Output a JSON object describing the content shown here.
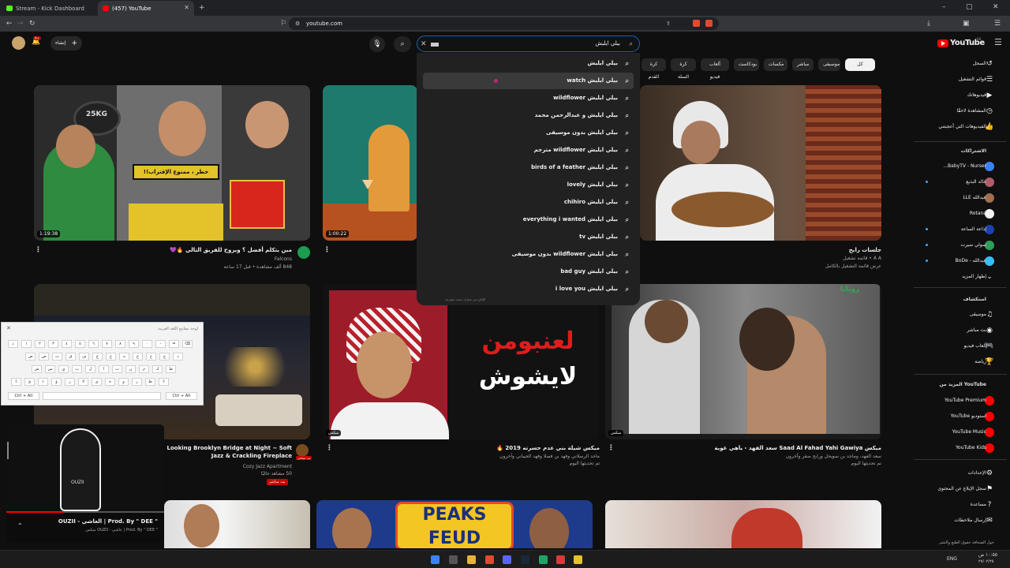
{
  "browser": {
    "tabs": [
      {
        "label": "Stream - Kick Dashboard",
        "active": false
      },
      {
        "label": "(457) YouTube",
        "active": true
      }
    ],
    "url": "youtube.com"
  },
  "youtube": {
    "logo": "YouTube",
    "region": "SA",
    "search_value": "بيلي ايليش",
    "create_label": "إنشاء",
    "notif_count": "9+",
    "chips": [
      "كل المحتوى",
      "موسيقى",
      "مباشر",
      "مكسات",
      "بودكاست",
      "ألعاب فيديو",
      "كرة السلة",
      "كرة القدم"
    ],
    "suggestions": [
      "بيلي ايليش",
      "بيلي ايليش watch",
      "بيلي ايليش wildflower",
      "بيلي ايليش و عبدالرحمن محمد",
      "بيلي ايليش بدون موسيقى",
      "بيلي ايليش wildflower مترجم",
      "بيلي ايليش birds of a feather",
      "بيلي ايليش lovely",
      "بيلي ايليش chihiro",
      "بيلي ايليش everything i wanted",
      "بيلي ايليش tv",
      "بيلي ايليش wildflower بدون موسيقى",
      "بيلي ايليش bad guy",
      "بيلي ايليش i love you"
    ],
    "suggest_footer": "الإبلاغ عن عبارات بحث مقترحة",
    "videos": [
      {
        "title": "مين يتكلم أفضل ؟ ويروح للفريق التالي 🔥💜",
        "channel": "Falcons",
        "meta": "848 ألف مشاهدة • قبل 17 ساعة",
        "duration": "1:19:38"
      },
      {
        "title": "",
        "channel": "",
        "meta": "",
        "duration": "1:00:22"
      },
      {
        "title": "جلسات رابح",
        "channel": "A A • قائمة تشغيل",
        "meta": "عرض قائمة التشغيل بالكامل",
        "duration": ""
      },
      {
        "title": "Looking Brooklyn Bridge at Night ~ Soft Jazz & Crackling Fireplace",
        "channel": "Cozy Jazz Apartment",
        "meta": "50 مشاهد حاليًا",
        "live": "بث مباشر"
      },
      {
        "title": "ميكس شيلة بني عدم حسرته 2019 🔥",
        "channel": "ماجد الرسلاني وفهد بن فصلا وفهد الجيباني وآخرون",
        "meta": "تم تحديثها اليوم",
        "mix": "ميكس"
      },
      {
        "title": "ميكس Saad Al Fahad Yahi Gawiya سعد الفهد - ياهي غوية",
        "channel": "سعد الفهد، وماجد بن سويحل ورابح صقر وآخرون",
        "meta": "تم تحديثها اليوم",
        "mix": "ميكس"
      }
    ],
    "thumb_texts": {
      "peaks": "PEAKS",
      "feud": "FEUD",
      "warning": "خطر ، ممنوع الإقتراب!!",
      "laanbo": "لعنبومن",
      "layshwsh": "لايشوش",
      "rotana": "روتانا",
      "kg": "25KG"
    },
    "sidebar": {
      "main": [
        "السجل",
        "قوائم التشغيل",
        "فيديوهاتك",
        "المشاهدة لاحقًا",
        "الفيديوهات التي أعجبتني"
      ],
      "subs_head": "الاشتراكات",
      "subs": [
        "BabyTV - Nurser...",
        "خالد البذيع",
        "عبدالله LLE",
        "Rotana",
        "إذاعة الساعة",
        "سولي سيرت",
        "عبدالله - BoDe"
      ],
      "show_more": "إظهار المزيد",
      "explore_head": "استكشاف",
      "explore": [
        "موسيقى",
        "بث مباشر",
        "ألعاب فيديو",
        "رياضة"
      ],
      "more_head": "المزيد من YouTube",
      "more": [
        "YouTube Premium",
        "استوديو YouTube",
        "YouTube Music",
        "YouTube Kids"
      ],
      "settings": [
        "الإعدادات",
        "سجل الإبلاغ عن المحتوى",
        "مساعدة",
        "إرسال ملاحظات"
      ],
      "footer": "حول   الصحافة   حقوق الطبع والنشر"
    },
    "miniplayer": {
      "title": "\" Prod. By \" DEE | العاشي - OUZII",
      "sub": "\" Prod. By \" DEE | عاشي - OUZII ميكس",
      "ouzii": "OUZII"
    }
  },
  "keyboard": {
    "title": "لوحة مفاتيح اللغة العربية",
    "row1": [
      "ذ",
      "١",
      "٢",
      "٣",
      "٤",
      "٥",
      "٦",
      "٧",
      "٨",
      "٩",
      "٠",
      "-",
      "=",
      "⌫"
    ],
    "row2": [
      "ض",
      "ص",
      "ث",
      "ق",
      "ف",
      "غ",
      "ع",
      "ه",
      "خ",
      "ح",
      "ج",
      "د"
    ],
    "row3": [
      "ش",
      "س",
      "ي",
      "ب",
      "ل",
      "ا",
      "ت",
      "ن",
      "م",
      "ك",
      "ط"
    ],
    "row4": [
      "⇧",
      "ئ",
      "ء",
      "ؤ",
      "ر",
      "لا",
      "ى",
      "ة",
      "و",
      "ز",
      "ظ",
      "⇧"
    ],
    "ctrl_alt": "Ctrl + Alt"
  },
  "taskbar": {
    "lang": "ENG",
    "time": "١٠:٥٥ ص",
    "date": "٢٧/٠٢/٢٥"
  },
  "colors": {
    "bg": "#0f0f0f",
    "accent": "#ff0000",
    "chrome": "#35363a"
  }
}
